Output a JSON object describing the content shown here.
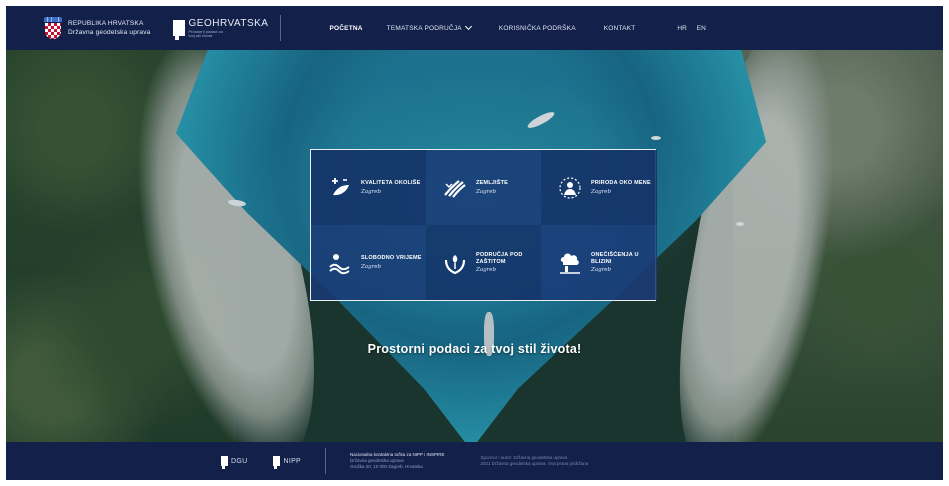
{
  "header": {
    "republika_line1": "Republika Hrvatska",
    "republika_line2": "Državna geodetska uprava",
    "geo_title": "GEOHRVATSKA",
    "geo_subtitle": "Prostorni podaci za tvoj stil života",
    "nav": [
      {
        "label": "Početna",
        "active": true
      },
      {
        "label": "Tematska područja",
        "dropdown": true
      },
      {
        "label": "Korisnička podrška"
      },
      {
        "label": "Kontakt"
      }
    ],
    "languages": [
      "HR",
      "EN"
    ]
  },
  "categories": [
    {
      "title": "Kvaliteta okoliše",
      "city": "Zagreb",
      "icon": "air-quality-icon"
    },
    {
      "title": "Zemljište",
      "city": "Zagreb",
      "icon": "land-icon"
    },
    {
      "title": "Priroda oko mene",
      "city": "Zagreb",
      "icon": "nature-icon"
    },
    {
      "title": "Slobodno vrijeme",
      "city": "Zagreb",
      "icon": "leisure-icon"
    },
    {
      "title": "Područja pod zaštitom",
      "city": "Zagreb",
      "icon": "protected-areas-icon"
    },
    {
      "title": "Onečišćenja u blizini",
      "city": "Zagreb",
      "icon": "pollution-icon"
    }
  ],
  "slogan": "Prostorni podaci za tvoj stil života!",
  "footer": {
    "logo1": "DGU",
    "logo2": "NIPP",
    "col1_head": "Nacionalna kontaktna točka za NIPP i INSPIRE",
    "col1_line2": "Državna geodetska uprava",
    "col1_line3": "Gruška 20, 10 000 Zagreb, Hrvatska",
    "col2_line1": "Sponzor i autor: Državna geodetska uprava",
    "col2_line2": "2021 Državna geodetska uprava. Sva prava pridržana"
  },
  "colors": {
    "navy": "#13204a",
    "tile": "#143066",
    "sea": "#1a6f8d"
  }
}
